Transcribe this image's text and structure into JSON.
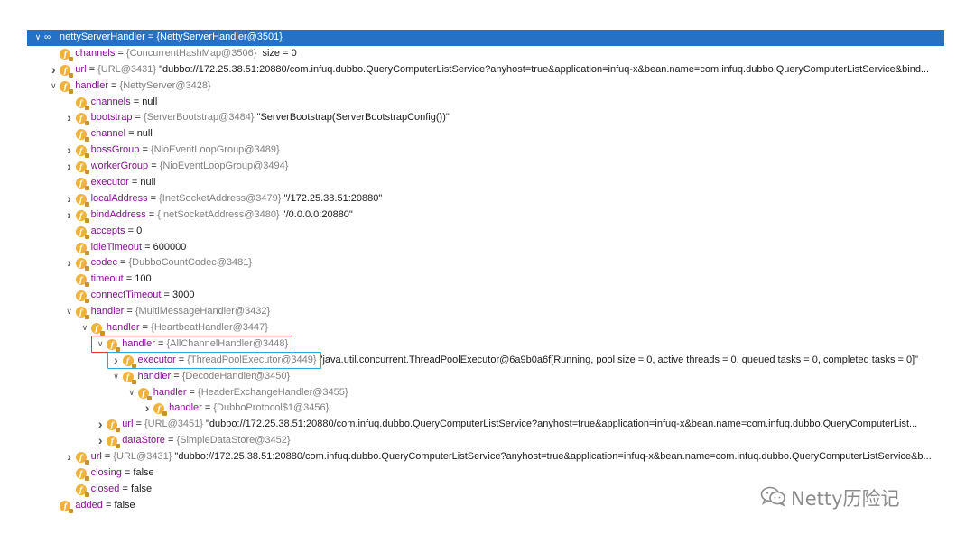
{
  "rows": [
    {
      "level": 0,
      "arrow": "down",
      "icon": "oo",
      "name": "nettyServerHandler",
      "eq": " = ",
      "meta": "{NettyServerHandler@3501}",
      "val": "",
      "selected": true
    },
    {
      "level": 1,
      "arrow": "",
      "icon": "f",
      "name": "channels",
      "eq": " = ",
      "meta": "{ConcurrentHashMap@3506}",
      "val": "  size = 0"
    },
    {
      "level": 1,
      "arrow": "right",
      "icon": "f",
      "name": "url",
      "eq": " = ",
      "meta": "{URL@3431}",
      "val": " \"dubbo://172.25.38.51:20880/com.infuq.dubbo.QueryComputerListService?anyhost=true&application=infuq-x&bean.name=com.infuq.dubbo.QueryComputerListService&bind..."
    },
    {
      "level": 1,
      "arrow": "down",
      "icon": "f",
      "name": "handler",
      "eq": " = ",
      "meta": "{NettyServer@3428}",
      "val": ""
    },
    {
      "level": 2,
      "arrow": "",
      "icon": "f",
      "name": "channels",
      "eq": " = ",
      "meta": "",
      "val": "null"
    },
    {
      "level": 2,
      "arrow": "right",
      "icon": "f",
      "name": "bootstrap",
      "eq": " = ",
      "meta": "{ServerBootstrap@3484}",
      "val": " \"ServerBootstrap(ServerBootstrapConfig())\""
    },
    {
      "level": 2,
      "arrow": "",
      "icon": "f",
      "name": "channel",
      "eq": " = ",
      "meta": "",
      "val": "null"
    },
    {
      "level": 2,
      "arrow": "right",
      "icon": "f",
      "name": "bossGroup",
      "eq": " = ",
      "meta": "{NioEventLoopGroup@3489}",
      "val": ""
    },
    {
      "level": 2,
      "arrow": "right",
      "icon": "f",
      "name": "workerGroup",
      "eq": " = ",
      "meta": "{NioEventLoopGroup@3494}",
      "val": ""
    },
    {
      "level": 2,
      "arrow": "",
      "icon": "f",
      "name": "executor",
      "eq": " = ",
      "meta": "",
      "val": "null"
    },
    {
      "level": 2,
      "arrow": "right",
      "icon": "f",
      "name": "localAddress",
      "eq": " = ",
      "meta": "{InetSocketAddress@3479}",
      "val": " \"/172.25.38.51:20880\""
    },
    {
      "level": 2,
      "arrow": "right",
      "icon": "f",
      "name": "bindAddress",
      "eq": " = ",
      "meta": "{InetSocketAddress@3480}",
      "val": " \"/0.0.0.0:20880\""
    },
    {
      "level": 2,
      "arrow": "",
      "icon": "f",
      "name": "accepts",
      "eq": " = ",
      "meta": "",
      "val": "0"
    },
    {
      "level": 2,
      "arrow": "",
      "icon": "f",
      "name": "idleTimeout",
      "eq": " = ",
      "meta": "",
      "val": "600000"
    },
    {
      "level": 2,
      "arrow": "right",
      "icon": "f",
      "name": "codec",
      "eq": " = ",
      "meta": "{DubboCountCodec@3481}",
      "val": ""
    },
    {
      "level": 2,
      "arrow": "",
      "icon": "f",
      "name": "timeout",
      "eq": " = ",
      "meta": "",
      "val": "100"
    },
    {
      "level": 2,
      "arrow": "",
      "icon": "f",
      "name": "connectTimeout",
      "eq": " = ",
      "meta": "",
      "val": "3000"
    },
    {
      "level": 2,
      "arrow": "down",
      "icon": "f",
      "name": "handler",
      "eq": " = ",
      "meta": "{MultiMessageHandler@3432}",
      "val": ""
    },
    {
      "level": 3,
      "arrow": "down",
      "icon": "f",
      "name": "handler",
      "eq": " = ",
      "meta": "{HeartbeatHandler@3447}",
      "val": ""
    },
    {
      "level": 4,
      "arrow": "down",
      "icon": "f",
      "name": "handler",
      "eq": " = ",
      "meta": "{AllChannelHandler@3448}",
      "val": "",
      "box": "red"
    },
    {
      "level": 5,
      "arrow": "right",
      "icon": "f",
      "name": "executor",
      "eq": " = ",
      "meta": "{ThreadPoolExecutor@3449}",
      "val": " \"java.util.concurrent.ThreadPoolExecutor@6a9b0a6f[Running, pool size = 0, active threads = 0, queued tasks = 0, completed tasks = 0]\"",
      "box": "blue"
    },
    {
      "level": 5,
      "arrow": "down",
      "icon": "f",
      "name": "handler",
      "eq": " = ",
      "meta": "{DecodeHandler@3450}",
      "val": ""
    },
    {
      "level": 6,
      "arrow": "down",
      "icon": "f",
      "name": "handler",
      "eq": " = ",
      "meta": "{HeaderExchangeHandler@3455}",
      "val": ""
    },
    {
      "level": 7,
      "arrow": "right",
      "icon": "f",
      "name": "handler",
      "eq": " = ",
      "meta": "{DubboProtocol$1@3456}",
      "val": ""
    },
    {
      "level": 4,
      "arrow": "right",
      "icon": "f",
      "name": "url",
      "eq": " = ",
      "meta": "{URL@3451}",
      "val": " \"dubbo://172.25.38.51:20880/com.infuq.dubbo.QueryComputerListService?anyhost=true&application=infuq-x&bean.name=com.infuq.dubbo.QueryComputerList..."
    },
    {
      "level": 4,
      "arrow": "right",
      "icon": "f",
      "name": "dataStore",
      "eq": " = ",
      "meta": "{SimpleDataStore@3452}",
      "val": ""
    },
    {
      "level": 2,
      "arrow": "right",
      "icon": "f",
      "name": "url",
      "eq": " = ",
      "meta": "{URL@3431}",
      "val": " \"dubbo://172.25.38.51:20880/com.infuq.dubbo.QueryComputerListService?anyhost=true&application=infuq-x&bean.name=com.infuq.dubbo.QueryComputerListService&b..."
    },
    {
      "level": 2,
      "arrow": "",
      "icon": "f",
      "name": "closing",
      "eq": " = ",
      "meta": "",
      "val": "false"
    },
    {
      "level": 2,
      "arrow": "",
      "icon": "f",
      "name": "closed",
      "eq": " = ",
      "meta": "",
      "val": "false"
    },
    {
      "level": 1,
      "arrow": "",
      "icon": "f",
      "name": "added",
      "eq": " = ",
      "meta": "",
      "val": "false"
    }
  ],
  "watermark": {
    "text": "Netty历险记",
    "icon": "wechat-icon"
  },
  "colors": {
    "selection": "#2671c4",
    "field_icon": "#f0b23a",
    "field_name": "#871094",
    "meta": "#808080",
    "red_box": "#e63636",
    "blue_box": "#2aa7df"
  }
}
